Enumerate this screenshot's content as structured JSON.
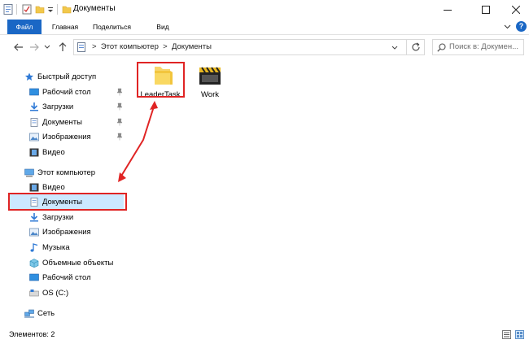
{
  "window": {
    "title": "Документы"
  },
  "ribbon": {
    "tabs": [
      "Файл",
      "Главная",
      "Поделиться",
      "Вид"
    ]
  },
  "address": {
    "path": [
      "Этот компьютер",
      "Документы"
    ],
    "search_placeholder": "Поиск в: Докумен..."
  },
  "nav": {
    "quick_access": {
      "label": "Быстрый доступ",
      "items": [
        "Рабочий стол",
        "Загрузки",
        "Документы",
        "Изображения",
        "Видео"
      ]
    },
    "this_pc": {
      "label": "Этот компьютер",
      "items": [
        "Видео",
        "Документы",
        "Загрузки",
        "Изображения",
        "Музыка",
        "Объемные объекты",
        "Рабочий стол",
        "OS (C:)"
      ]
    },
    "network": "Сеть"
  },
  "files": [
    {
      "name": "LeaderTask",
      "icon": "folder-icon"
    },
    {
      "name": "Work",
      "icon": "clapperboard-icon"
    }
  ],
  "status": {
    "items_count": "Элементов: 2"
  },
  "colors": {
    "accent": "#1a67c5",
    "selection": "#cce8ff",
    "highlight": "#e02424"
  }
}
